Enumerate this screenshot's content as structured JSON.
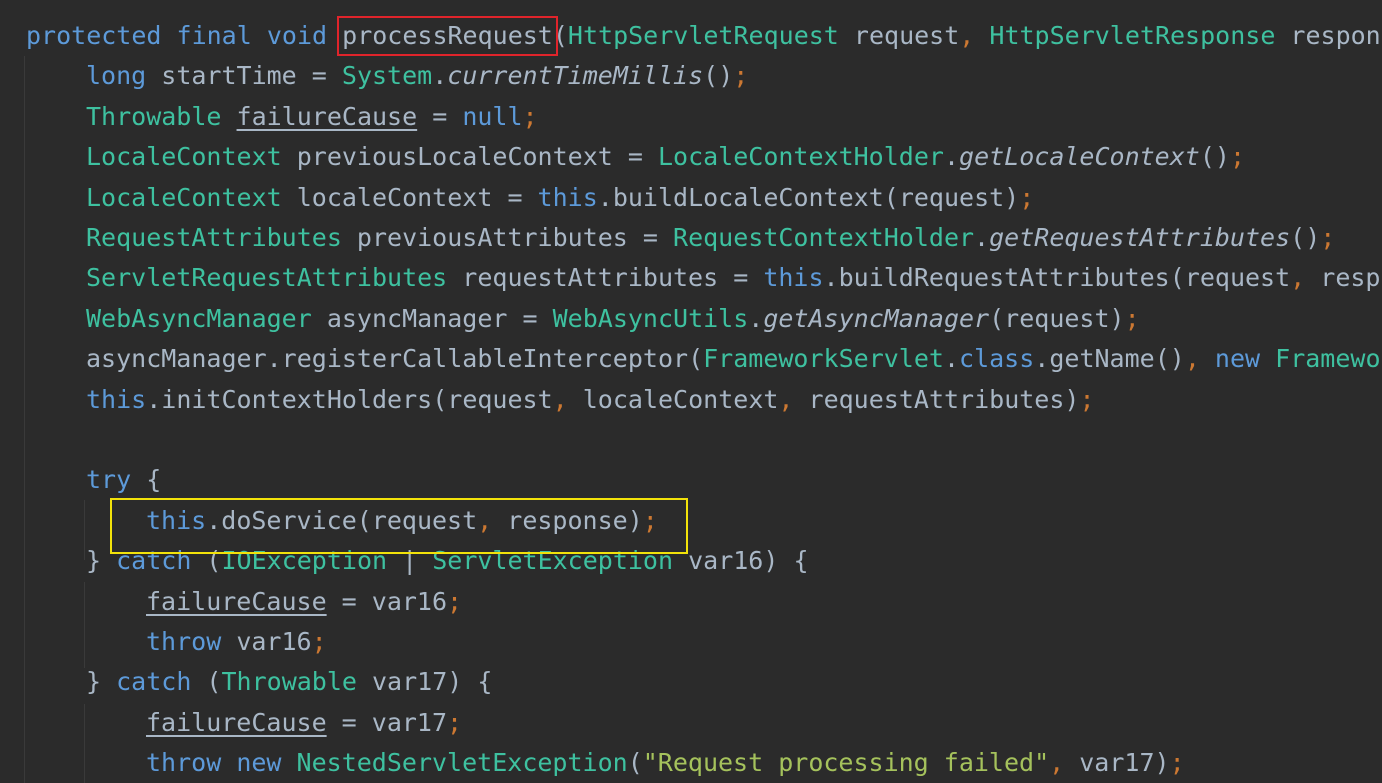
{
  "code": {
    "lines": [
      {
        "indent": 0,
        "tokens": [
          {
            "t": "protected",
            "c": "kw"
          },
          {
            "t": " ",
            "c": "ident"
          },
          {
            "t": "final",
            "c": "kw"
          },
          {
            "t": " ",
            "c": "ident"
          },
          {
            "t": "void",
            "c": "kw"
          },
          {
            "t": " ",
            "c": "ident"
          },
          {
            "t": "processRequest",
            "c": "method"
          },
          {
            "t": "(",
            "c": "punc"
          },
          {
            "t": "HttpServletRequest",
            "c": "type"
          },
          {
            "t": " request",
            "c": "ident"
          },
          {
            "t": ", ",
            "c": "op"
          },
          {
            "t": "HttpServletResponse",
            "c": "type"
          },
          {
            "t": " response",
            "c": "ident"
          }
        ]
      },
      {
        "indent": 1,
        "tokens": [
          {
            "t": "long",
            "c": "kw"
          },
          {
            "t": " startTime = ",
            "c": "ident"
          },
          {
            "t": "System",
            "c": "type"
          },
          {
            "t": ".",
            "c": "punc"
          },
          {
            "t": "currentTimeMillis",
            "c": "static"
          },
          {
            "t": "()",
            "c": "punc"
          },
          {
            "t": ";",
            "c": "op"
          }
        ]
      },
      {
        "indent": 1,
        "tokens": [
          {
            "t": "Throwable",
            "c": "type"
          },
          {
            "t": " ",
            "c": "ident"
          },
          {
            "t": "failureCause",
            "c": "und"
          },
          {
            "t": " = ",
            "c": "ident"
          },
          {
            "t": "null",
            "c": "kw"
          },
          {
            "t": ";",
            "c": "op"
          }
        ]
      },
      {
        "indent": 1,
        "tokens": [
          {
            "t": "LocaleContext",
            "c": "type"
          },
          {
            "t": " previousLocaleContext = ",
            "c": "ident"
          },
          {
            "t": "LocaleContextHolder",
            "c": "type"
          },
          {
            "t": ".",
            "c": "punc"
          },
          {
            "t": "getLocaleContext",
            "c": "static"
          },
          {
            "t": "()",
            "c": "punc"
          },
          {
            "t": ";",
            "c": "op"
          }
        ]
      },
      {
        "indent": 1,
        "tokens": [
          {
            "t": "LocaleContext",
            "c": "type"
          },
          {
            "t": " localeContext = ",
            "c": "ident"
          },
          {
            "t": "this",
            "c": "kw"
          },
          {
            "t": ".",
            "c": "punc"
          },
          {
            "t": "buildLocaleContext",
            "c": "method"
          },
          {
            "t": "(request)",
            "c": "punc"
          },
          {
            "t": ";",
            "c": "op"
          }
        ]
      },
      {
        "indent": 1,
        "tokens": [
          {
            "t": "RequestAttributes",
            "c": "type"
          },
          {
            "t": " previousAttributes = ",
            "c": "ident"
          },
          {
            "t": "RequestContextHolder",
            "c": "type"
          },
          {
            "t": ".",
            "c": "punc"
          },
          {
            "t": "getRequestAttributes",
            "c": "static"
          },
          {
            "t": "()",
            "c": "punc"
          },
          {
            "t": ";",
            "c": "op"
          }
        ]
      },
      {
        "indent": 1,
        "tokens": [
          {
            "t": "ServletRequestAttributes",
            "c": "type"
          },
          {
            "t": " requestAttributes = ",
            "c": "ident"
          },
          {
            "t": "this",
            "c": "kw"
          },
          {
            "t": ".",
            "c": "punc"
          },
          {
            "t": "buildRequestAttributes",
            "c": "method"
          },
          {
            "t": "(request",
            "c": "punc"
          },
          {
            "t": ", ",
            "c": "op"
          },
          {
            "t": "respo",
            "c": "ident"
          }
        ]
      },
      {
        "indent": 1,
        "tokens": [
          {
            "t": "WebAsyncManager",
            "c": "type"
          },
          {
            "t": " asyncManager = ",
            "c": "ident"
          },
          {
            "t": "WebAsyncUtils",
            "c": "type"
          },
          {
            "t": ".",
            "c": "punc"
          },
          {
            "t": "getAsyncManager",
            "c": "static"
          },
          {
            "t": "(request)",
            "c": "punc"
          },
          {
            "t": ";",
            "c": "op"
          }
        ]
      },
      {
        "indent": 1,
        "tokens": [
          {
            "t": "asyncManager.",
            "c": "ident"
          },
          {
            "t": "registerCallableInterceptor",
            "c": "method"
          },
          {
            "t": "(",
            "c": "punc"
          },
          {
            "t": "FrameworkServlet",
            "c": "type"
          },
          {
            "t": ".",
            "c": "punc"
          },
          {
            "t": "class",
            "c": "kw"
          },
          {
            "t": ".",
            "c": "punc"
          },
          {
            "t": "getName",
            "c": "method"
          },
          {
            "t": "()",
            "c": "punc"
          },
          {
            "t": ", ",
            "c": "op"
          },
          {
            "t": "new",
            "c": "kw"
          },
          {
            "t": " ",
            "c": "ident"
          },
          {
            "t": "Framewor",
            "c": "type"
          }
        ]
      },
      {
        "indent": 1,
        "tokens": [
          {
            "t": "this",
            "c": "kw"
          },
          {
            "t": ".",
            "c": "punc"
          },
          {
            "t": "initContextHolders",
            "c": "method"
          },
          {
            "t": "(request",
            "c": "punc"
          },
          {
            "t": ", ",
            "c": "op"
          },
          {
            "t": "localeContext",
            "c": "ident"
          },
          {
            "t": ", ",
            "c": "op"
          },
          {
            "t": "requestAttributes)",
            "c": "ident"
          },
          {
            "t": ";",
            "c": "op"
          }
        ]
      },
      {
        "indent": 1,
        "tokens": []
      },
      {
        "indent": 1,
        "tokens": [
          {
            "t": "try",
            "c": "kw"
          },
          {
            "t": " {",
            "c": "punc"
          }
        ]
      },
      {
        "indent": 2,
        "tokens": [
          {
            "t": "this",
            "c": "kw"
          },
          {
            "t": ".",
            "c": "punc"
          },
          {
            "t": "doService",
            "c": "method"
          },
          {
            "t": "(request",
            "c": "punc"
          },
          {
            "t": ", ",
            "c": "op"
          },
          {
            "t": "response)",
            "c": "ident"
          },
          {
            "t": ";",
            "c": "op"
          }
        ]
      },
      {
        "indent": 1,
        "tokens": [
          {
            "t": "} ",
            "c": "punc"
          },
          {
            "t": "catch",
            "c": "kw"
          },
          {
            "t": " (",
            "c": "punc"
          },
          {
            "t": "IOException",
            "c": "type"
          },
          {
            "t": " | ",
            "c": "ident"
          },
          {
            "t": "ServletException",
            "c": "type"
          },
          {
            "t": " var16) {",
            "c": "ident"
          }
        ]
      },
      {
        "indent": 2,
        "tokens": [
          {
            "t": "failureCause",
            "c": "und"
          },
          {
            "t": " = var16",
            "c": "ident"
          },
          {
            "t": ";",
            "c": "op"
          }
        ]
      },
      {
        "indent": 2,
        "tokens": [
          {
            "t": "throw",
            "c": "kw"
          },
          {
            "t": " var16",
            "c": "ident"
          },
          {
            "t": ";",
            "c": "op"
          }
        ]
      },
      {
        "indent": 1,
        "tokens": [
          {
            "t": "} ",
            "c": "punc"
          },
          {
            "t": "catch",
            "c": "kw"
          },
          {
            "t": " (",
            "c": "punc"
          },
          {
            "t": "Throwable",
            "c": "type"
          },
          {
            "t": " var17) {",
            "c": "ident"
          }
        ]
      },
      {
        "indent": 2,
        "tokens": [
          {
            "t": "failureCause",
            "c": "und"
          },
          {
            "t": " = var17",
            "c": "ident"
          },
          {
            "t": ";",
            "c": "op"
          }
        ]
      },
      {
        "indent": 2,
        "tokens": [
          {
            "t": "throw",
            "c": "kw"
          },
          {
            "t": " ",
            "c": "ident"
          },
          {
            "t": "new",
            "c": "kw"
          },
          {
            "t": " ",
            "c": "ident"
          },
          {
            "t": "NestedServletException",
            "c": "type"
          },
          {
            "t": "(",
            "c": "punc"
          },
          {
            "t": "\"Request processing failed\"",
            "c": "str"
          },
          {
            "t": ", ",
            "c": "op"
          },
          {
            "t": "var17)",
            "c": "ident"
          },
          {
            "t": ";",
            "c": "op"
          }
        ]
      }
    ]
  },
  "theme": {
    "background": "#2b2b2b",
    "keyword": "#5d9ad9",
    "type": "#3ec1a0",
    "identifier": "#a9b7c6",
    "separator": "#cc7832",
    "string": "#a5c25c",
    "highlight_red": "#e0242b",
    "highlight_yellow": "#f2e20a"
  }
}
